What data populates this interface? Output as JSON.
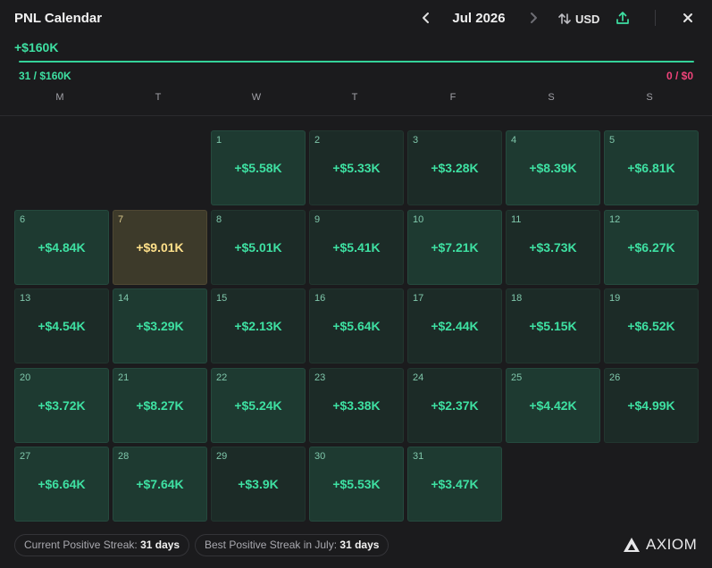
{
  "header": {
    "title": "PNL Calendar",
    "month": "Jul 2026",
    "currency": "USD",
    "prev_icon": "chevron-left-icon",
    "next_icon": "chevron-right-icon",
    "currency_icon": "swap-vertical-icon",
    "share_icon": "share-upload-icon",
    "close_icon": "close-icon"
  },
  "summary": {
    "total": "+$160K",
    "left": "31 / $160K",
    "right": "0 / $0",
    "positive_color": "#34d399",
    "negative_color": "#f0437a"
  },
  "weekdays": [
    "M",
    "T",
    "W",
    "T",
    "F",
    "S",
    "S"
  ],
  "days": [
    {
      "day": "1",
      "value": "+$5.58K"
    },
    {
      "day": "2",
      "value": "+$5.33K"
    },
    {
      "day": "3",
      "value": "+$3.28K"
    },
    {
      "day": "4",
      "value": "+$8.39K"
    },
    {
      "day": "5",
      "value": "+$6.81K"
    },
    {
      "day": "6",
      "value": "+$4.84K"
    },
    {
      "day": "7",
      "value": "+$9.01K",
      "best": true
    },
    {
      "day": "8",
      "value": "+$5.01K"
    },
    {
      "day": "9",
      "value": "+$5.41K"
    },
    {
      "day": "10",
      "value": "+$7.21K"
    },
    {
      "day": "11",
      "value": "+$3.73K"
    },
    {
      "day": "12",
      "value": "+$6.27K"
    },
    {
      "day": "13",
      "value": "+$4.54K"
    },
    {
      "day": "14",
      "value": "+$3.29K"
    },
    {
      "day": "15",
      "value": "+$2.13K"
    },
    {
      "day": "16",
      "value": "+$5.64K"
    },
    {
      "day": "17",
      "value": "+$2.44K"
    },
    {
      "day": "18",
      "value": "+$5.15K"
    },
    {
      "day": "19",
      "value": "+$6.52K"
    },
    {
      "day": "20",
      "value": "+$3.72K"
    },
    {
      "day": "21",
      "value": "+$8.27K"
    },
    {
      "day": "22",
      "value": "+$5.24K"
    },
    {
      "day": "23",
      "value": "+$3.38K"
    },
    {
      "day": "24",
      "value": "+$2.37K"
    },
    {
      "day": "25",
      "value": "+$4.42K"
    },
    {
      "day": "26",
      "value": "+$4.99K"
    },
    {
      "day": "27",
      "value": "+$6.64K"
    },
    {
      "day": "28",
      "value": "+$7.64K"
    },
    {
      "day": "29",
      "value": "+$3.9K"
    },
    {
      "day": "30",
      "value": "+$5.53K"
    },
    {
      "day": "31",
      "value": "+$3.47K"
    }
  ],
  "footer": {
    "current_streak_label": "Current Positive Streak:",
    "current_streak_value": "31 days",
    "best_streak_label": "Best Positive Streak in July:",
    "best_streak_value": "31 days",
    "brand": "AXIOM",
    "brand_icon": "axiom-logo-icon"
  }
}
